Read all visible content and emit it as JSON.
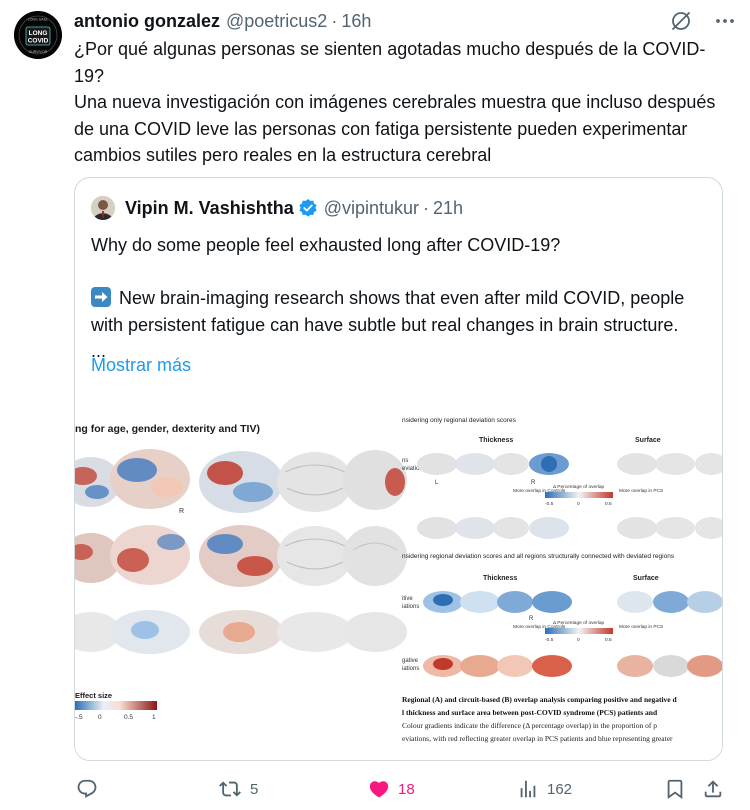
{
  "tweet": {
    "author_name": "antonio gonzalez",
    "author_handle": "@poetricus2",
    "dot": "·",
    "time": "16h",
    "avatar_text": {
      "top": "LONG HAUL",
      "line1": "LONG",
      "line2": "COVID",
      "bottom": "SURVIVOR"
    },
    "text_line1": "¿Por qué algunas personas se sienten agotadas mucho después de la COVID-19?",
    "text_line2": "Una nueva investigación con imágenes cerebrales muestra que incluso después de una COVID leve las personas con fatiga persistente pueden experimentar cambios sutiles pero reales en la estructura cerebral"
  },
  "quote": {
    "author_name": "Vipin M. Vashishtha",
    "author_handle": "@vipintukur",
    "dot": "·",
    "time": "21h",
    "line1": "Why do some people feel exhausted long after COVID-19?",
    "line2": "New brain-imaging research shows that even after mild COVID, people with persistent fatigue can have subtle but real changes in brain structure.",
    "ellipsis": "...",
    "show_more": "Mostrar más",
    "image": {
      "left_title": "ng for age, gender, dexterity and TIV)",
      "left_R": "R",
      "left_legend_title": "Effect size",
      "left_legend_ticks": [
        "-.5",
        "0",
        "0.5",
        "1"
      ],
      "right_a_title": "nsidering only regional deviation scores",
      "thickness": "Thickness",
      "surface": "Surface",
      "right_rows_a": [
        "ns",
        "eviations"
      ],
      "L": "L",
      "R": "R",
      "legend_more_controls": "More overlap in Controls",
      "legend_pct": "Δ Percentage of overlap",
      "legend_more_pcs": "More overlap in PCS",
      "legend_ticks": [
        "-0.5",
        "0",
        "0.5"
      ],
      "right_b_title": "nsidering regional deviation scores and all regions structurally connected with deviated regions",
      "right_rows_b": [
        "itive",
        "iations",
        "gative",
        "iations"
      ],
      "caption_line1": "Regional (A) and circuit-based (B) overlap analysis comparing positive and negative d",
      "caption_line2": "l thickness and surface area between post-COVID syndrome (PCS) patients and",
      "caption_line3": "Colour gradients indicate the difference (Δ percentage overlap) in the proportion of p",
      "caption_line4": "eviations, with red reflecting greater overlap in PCS patients and blue representing greater"
    }
  },
  "actions": {
    "reply": "",
    "retweets": "5",
    "likes": "18",
    "views": "162"
  },
  "colors": {
    "text": "#0f1419",
    "muted": "#536471",
    "link": "#1d9bf0",
    "like": "#f91880",
    "border": "#cfd9de"
  }
}
